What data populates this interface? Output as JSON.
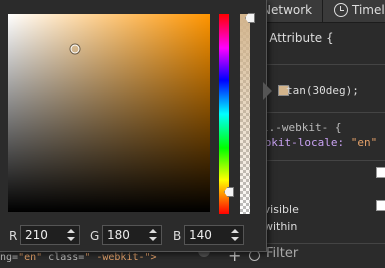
{
  "tabs": {
    "network": "Network",
    "timeline": "Timeli"
  },
  "styles": {
    "attribute_line": "e Attribute {",
    "tan_value": "tan(30deg);",
    "webkit_line1": "l.-webkit- {",
    "webkit_locale_prop": "ebkit-locale: ",
    "webkit_locale_value": "\"en\""
  },
  "states": [
    {
      "label": "e"
    },
    {
      "label": "-visible"
    },
    {
      "label": "-within"
    }
  ],
  "filter": {
    "add_label": "+",
    "placeholder": "Filter"
  },
  "breadcrumb": {
    "prefix": "ng=",
    "lang_val": "\"en\"",
    "mid": " class=",
    "class_val": "\" -webkit-\">"
  },
  "picker": {
    "hue_color": "#ff9500",
    "swatch_color": "#d2b48c",
    "r": {
      "label": "R",
      "value": "210"
    },
    "g": {
      "label": "G",
      "value": "180"
    },
    "b": {
      "label": "B",
      "value": "140"
    }
  }
}
